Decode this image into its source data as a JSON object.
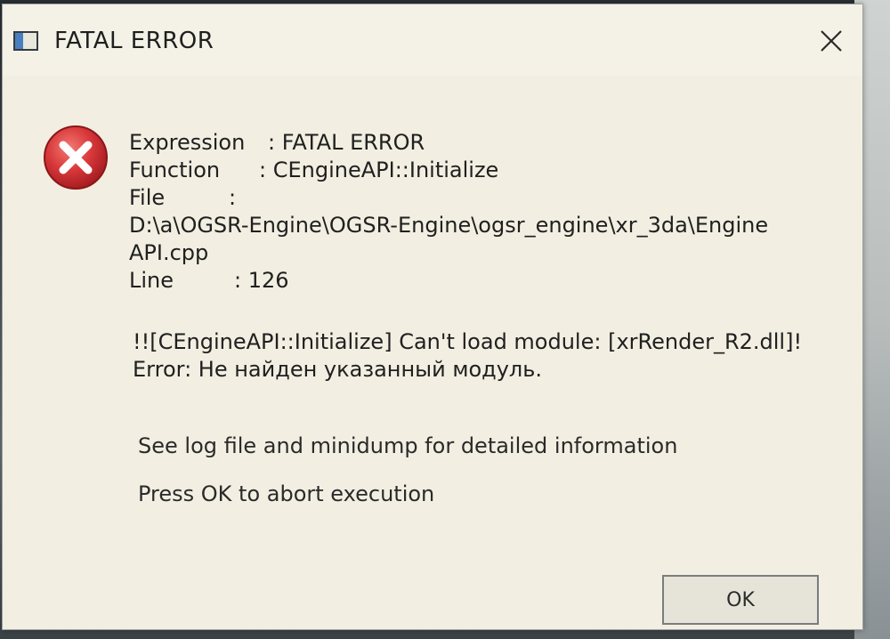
{
  "window": {
    "title": "FATAL ERROR",
    "close_icon": "close-icon",
    "app_icon": "window-icon"
  },
  "error": {
    "icon": "error-icon",
    "icon_color": "#d8383a",
    "expression_label": "Expression",
    "expression_value": ": FATAL ERROR",
    "function_label": "Function",
    "function_value": ": CEngineAPI::Initialize",
    "file_label": "File",
    "file_value": ":",
    "file_path_line1": "D:\\a\\OGSR-Engine\\OGSR-Engine\\ogsr_engine\\xr_3da\\Engine",
    "file_path_line2": "API.cpp",
    "line_label": "Line",
    "line_value": ": 126",
    "message_line1": "!![CEngineAPI::Initialize] Can't load module: [xrRender_R2.dll]!",
    "message_line2": "Error: Не найден указанный модуль."
  },
  "info": {
    "log_hint": "See log file and minidump for detailed information",
    "abort_hint": "Press OK to abort execution"
  },
  "buttons": {
    "ok_label": "OK"
  }
}
